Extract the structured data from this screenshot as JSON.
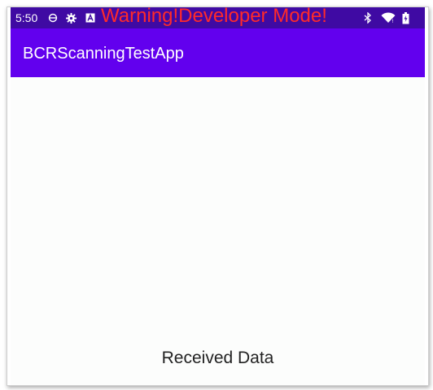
{
  "status_bar": {
    "time": "5:50",
    "warning": "Warning!Developer Mode!",
    "warning_color": "#ff2a2a",
    "background_color": "#3f0aa3",
    "icons": [
      "sync-icon",
      "gear-icon",
      "a-box-icon",
      "bluetooth-icon",
      "wifi-icon",
      "battery-icon"
    ]
  },
  "app_bar": {
    "title": "BCRScanningTestApp",
    "background_color": "#6200ee"
  },
  "main": {
    "received_label": "Received Data"
  }
}
